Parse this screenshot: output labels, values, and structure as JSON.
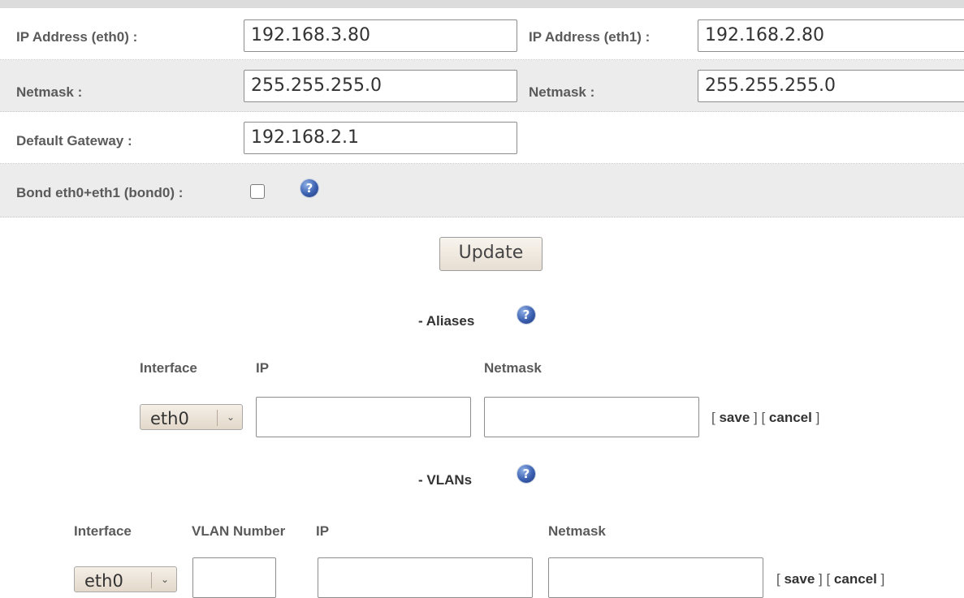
{
  "network": {
    "eth0": {
      "ip_label": "IP Address (eth0) :",
      "ip_value": "192.168.3.80",
      "netmask_label": "Netmask :",
      "netmask_value": "255.255.255.0"
    },
    "eth1": {
      "ip_label": "IP Address (eth1) :",
      "ip_value": "192.168.2.80",
      "netmask_label": "Netmask :",
      "netmask_value": "255.255.255.0"
    },
    "gateway_label": "Default Gateway :",
    "gateway_value": "192.168.2.1",
    "bond_label": "Bond eth0+eth1 (bond0) :",
    "bond_checked": false,
    "update_label": "Update",
    "help_glyph": "?"
  },
  "aliases": {
    "title": "- Aliases",
    "columns": [
      "Interface",
      "IP",
      "Netmask"
    ],
    "interface_selected": "eth0",
    "ip_value": "",
    "netmask_value": "",
    "save_label": "save",
    "cancel_label": "cancel"
  },
  "vlans": {
    "title": "- VLANs",
    "columns": [
      "Interface",
      "VLAN Number",
      "IP",
      "Netmask"
    ],
    "interface_selected": "eth0",
    "vlan_number_value": "",
    "ip_value": "",
    "netmask_value": "",
    "save_label": "save",
    "cancel_label": "cancel"
  },
  "icons": {
    "help": "help-icon",
    "dropdown": "chevron-down-icon"
  },
  "colors": {
    "help_blue": "#3b5fb0",
    "row_shade": "#ececec"
  }
}
